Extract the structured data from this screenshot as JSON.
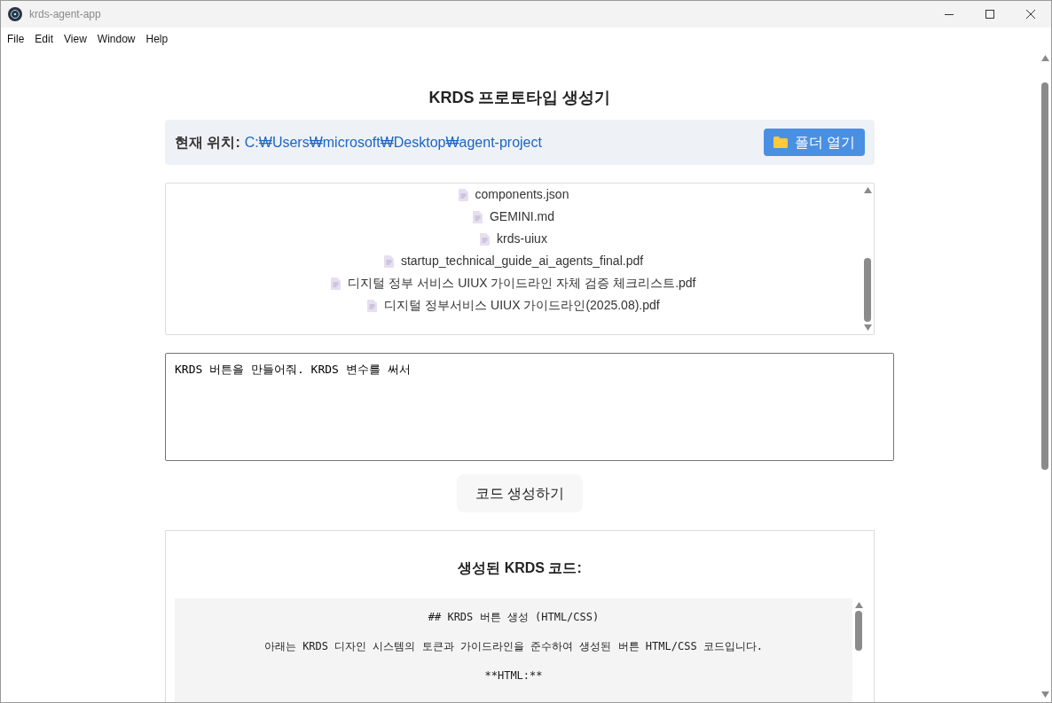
{
  "window": {
    "title": "krds-agent-app"
  },
  "menu": [
    "File",
    "Edit",
    "View",
    "Window",
    "Help"
  ],
  "page_title": "KRDS 프로토타입 생성기",
  "location": {
    "label": "현재 위치:",
    "path": "C:₩Users₩microsoft₩Desktop₩agent-project",
    "button": "폴더 열기"
  },
  "files": [
    "components.json",
    "GEMINI.md",
    "krds-uiux",
    "startup_technical_guide_ai_agents_final.pdf",
    "디지털 정부 서비스 UIUX 가이드라인 자체 검증 체크리스트.pdf",
    "디지털 정부서비스 UIUX 가이드라인(2025.08).pdf"
  ],
  "prompt": {
    "value": "KRDS 버튼을 만들어줘. KRDS 변수를 써서"
  },
  "generate_button": "코드 생성하기",
  "output": {
    "heading": "생성된 KRDS 코드:",
    "lines": [
      "## KRDS 버튼 생성 (HTML/CSS)",
      "아래는 KRDS 디자인 시스템의 토큰과 가이드라인을 준수하여 생성된 버튼 HTML/CSS 코드입니다.",
      "**HTML:**"
    ]
  }
}
